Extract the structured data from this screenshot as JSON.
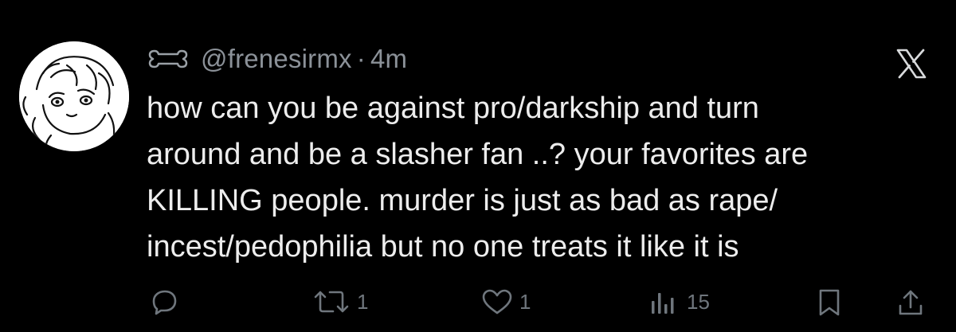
{
  "author": {
    "handle": "@frenesirmx",
    "separator": "·",
    "time": "4m"
  },
  "tweet": {
    "text": "how can you be against pro/darkship and turn\naround and be a slasher fan ..? your favorites are\nKILLING people. murder is just as bad as rape/\nincest/pedophilia but no one treats it like it is"
  },
  "actions": {
    "reply_count": "",
    "retweet_count": "1",
    "like_count": "1",
    "views_count": "15"
  },
  "icons": {
    "name_icon": "bone-icon",
    "brand": "x-logo-icon"
  },
  "colors": {
    "background": "#000000",
    "text": "#ededed",
    "muted": "#8b9198",
    "icon": "#6f767d"
  }
}
